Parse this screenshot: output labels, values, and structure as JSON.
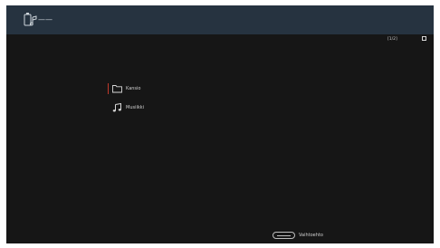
{
  "header": {
    "app_icon": "music-device-icon",
    "title": "——"
  },
  "toolbar": {
    "counter": "[1/2]",
    "select_icon": "checkbox-icon"
  },
  "list": {
    "items": [
      {
        "label": "Kansio",
        "icon": "folder-icon",
        "selected": true
      },
      {
        "label": "Musiikki",
        "icon": "music-note-icon",
        "selected": false
      }
    ]
  },
  "footer": {
    "key_icon": "option-key-icon",
    "label": "Vaihtoehto"
  },
  "colors": {
    "header_bg": "#263340",
    "body_bg": "#161616",
    "selection_marker": "#c0392b",
    "text": "#d0d0d0"
  }
}
